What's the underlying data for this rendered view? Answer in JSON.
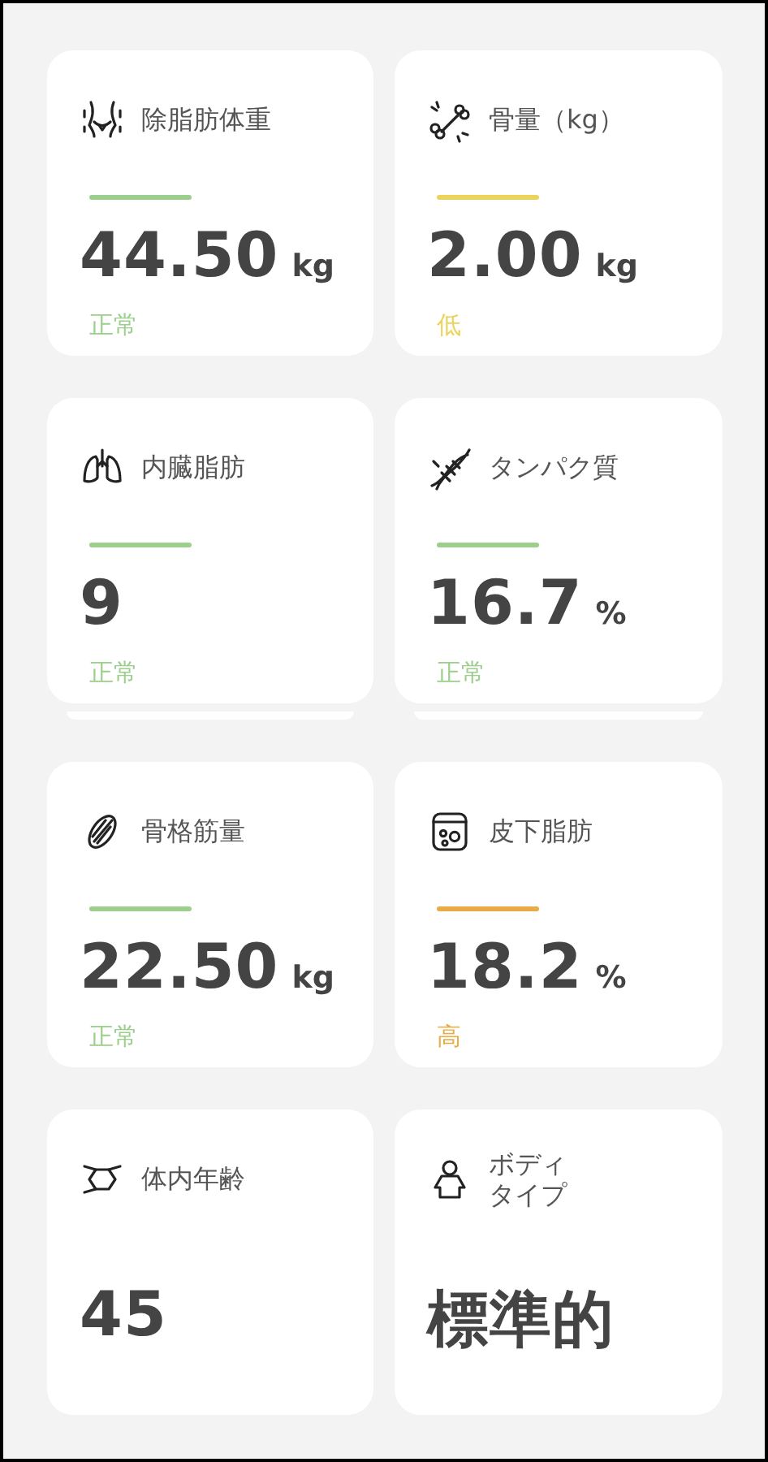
{
  "cards": [
    {
      "title": "除脂肪体重",
      "value": "44.50",
      "unit": "kg",
      "status": {
        "label": "正常",
        "color": "#9ccf8c"
      }
    },
    {
      "title": "骨量（kg）",
      "value": "2.00",
      "unit": "kg",
      "status": {
        "label": "低",
        "color": "#ecd35c"
      }
    },
    {
      "title": "内臓脂肪",
      "value": "9",
      "status": {
        "label": "正常",
        "color": "#9ccf8c"
      }
    },
    {
      "title": "タンパク質",
      "value": "16.7",
      "unit": "%",
      "status": {
        "label": "正常",
        "color": "#9ccf8c"
      }
    },
    {
      "title": "骨格筋量",
      "value": "22.50",
      "unit": "kg",
      "status": {
        "label": "正常",
        "color": "#9ccf8c"
      }
    },
    {
      "title": "皮下脂肪",
      "value": "18.2",
      "unit": "%",
      "status": {
        "label": "高",
        "color": "#e8ab45"
      }
    },
    {
      "title": "体内年齢",
      "value": "45"
    },
    {
      "title": "ボディタイプ",
      "value": "標準的"
    }
  ]
}
